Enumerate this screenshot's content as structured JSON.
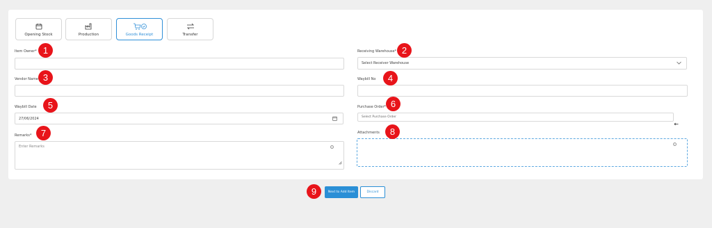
{
  "tabs": [
    {
      "label": "Opening Stock",
      "icon": "calendar-icon"
    },
    {
      "label": "Production",
      "icon": "factory-icon"
    },
    {
      "label": "Goods Receipt",
      "icon": "cart-check-icon"
    },
    {
      "label": "Transfer",
      "icon": "transfer-arrows-icon"
    }
  ],
  "active_tab": "Goods Receipt",
  "fields": {
    "item_owner": {
      "label": "Item Owner*",
      "value": ""
    },
    "receiving_warehouse": {
      "label": "Receiving Warehouse*",
      "value": "Select Receiver Warehouse"
    },
    "vendor_name": {
      "label": "Vendor Name*",
      "value": ""
    },
    "waybill_no": {
      "label": "Waybill No",
      "value": ""
    },
    "waybill_date": {
      "label": "Waybill Date",
      "value": "27/06/2024"
    },
    "purchase_order": {
      "label": "Purchase Order*",
      "value": "Select Purchase Order"
    },
    "remarks": {
      "label": "Remarks*",
      "placeholder": "Enter Remarks"
    },
    "attachments": {
      "label": "Attachments"
    }
  },
  "markers": [
    "1",
    "2",
    "3",
    "4",
    "5",
    "6",
    "7",
    "8",
    "9"
  ],
  "buttons": {
    "next": "Next to Add Item",
    "discard": "Discard"
  },
  "colors": {
    "accent": "#2a8fd6",
    "marker": "#e8141a"
  }
}
